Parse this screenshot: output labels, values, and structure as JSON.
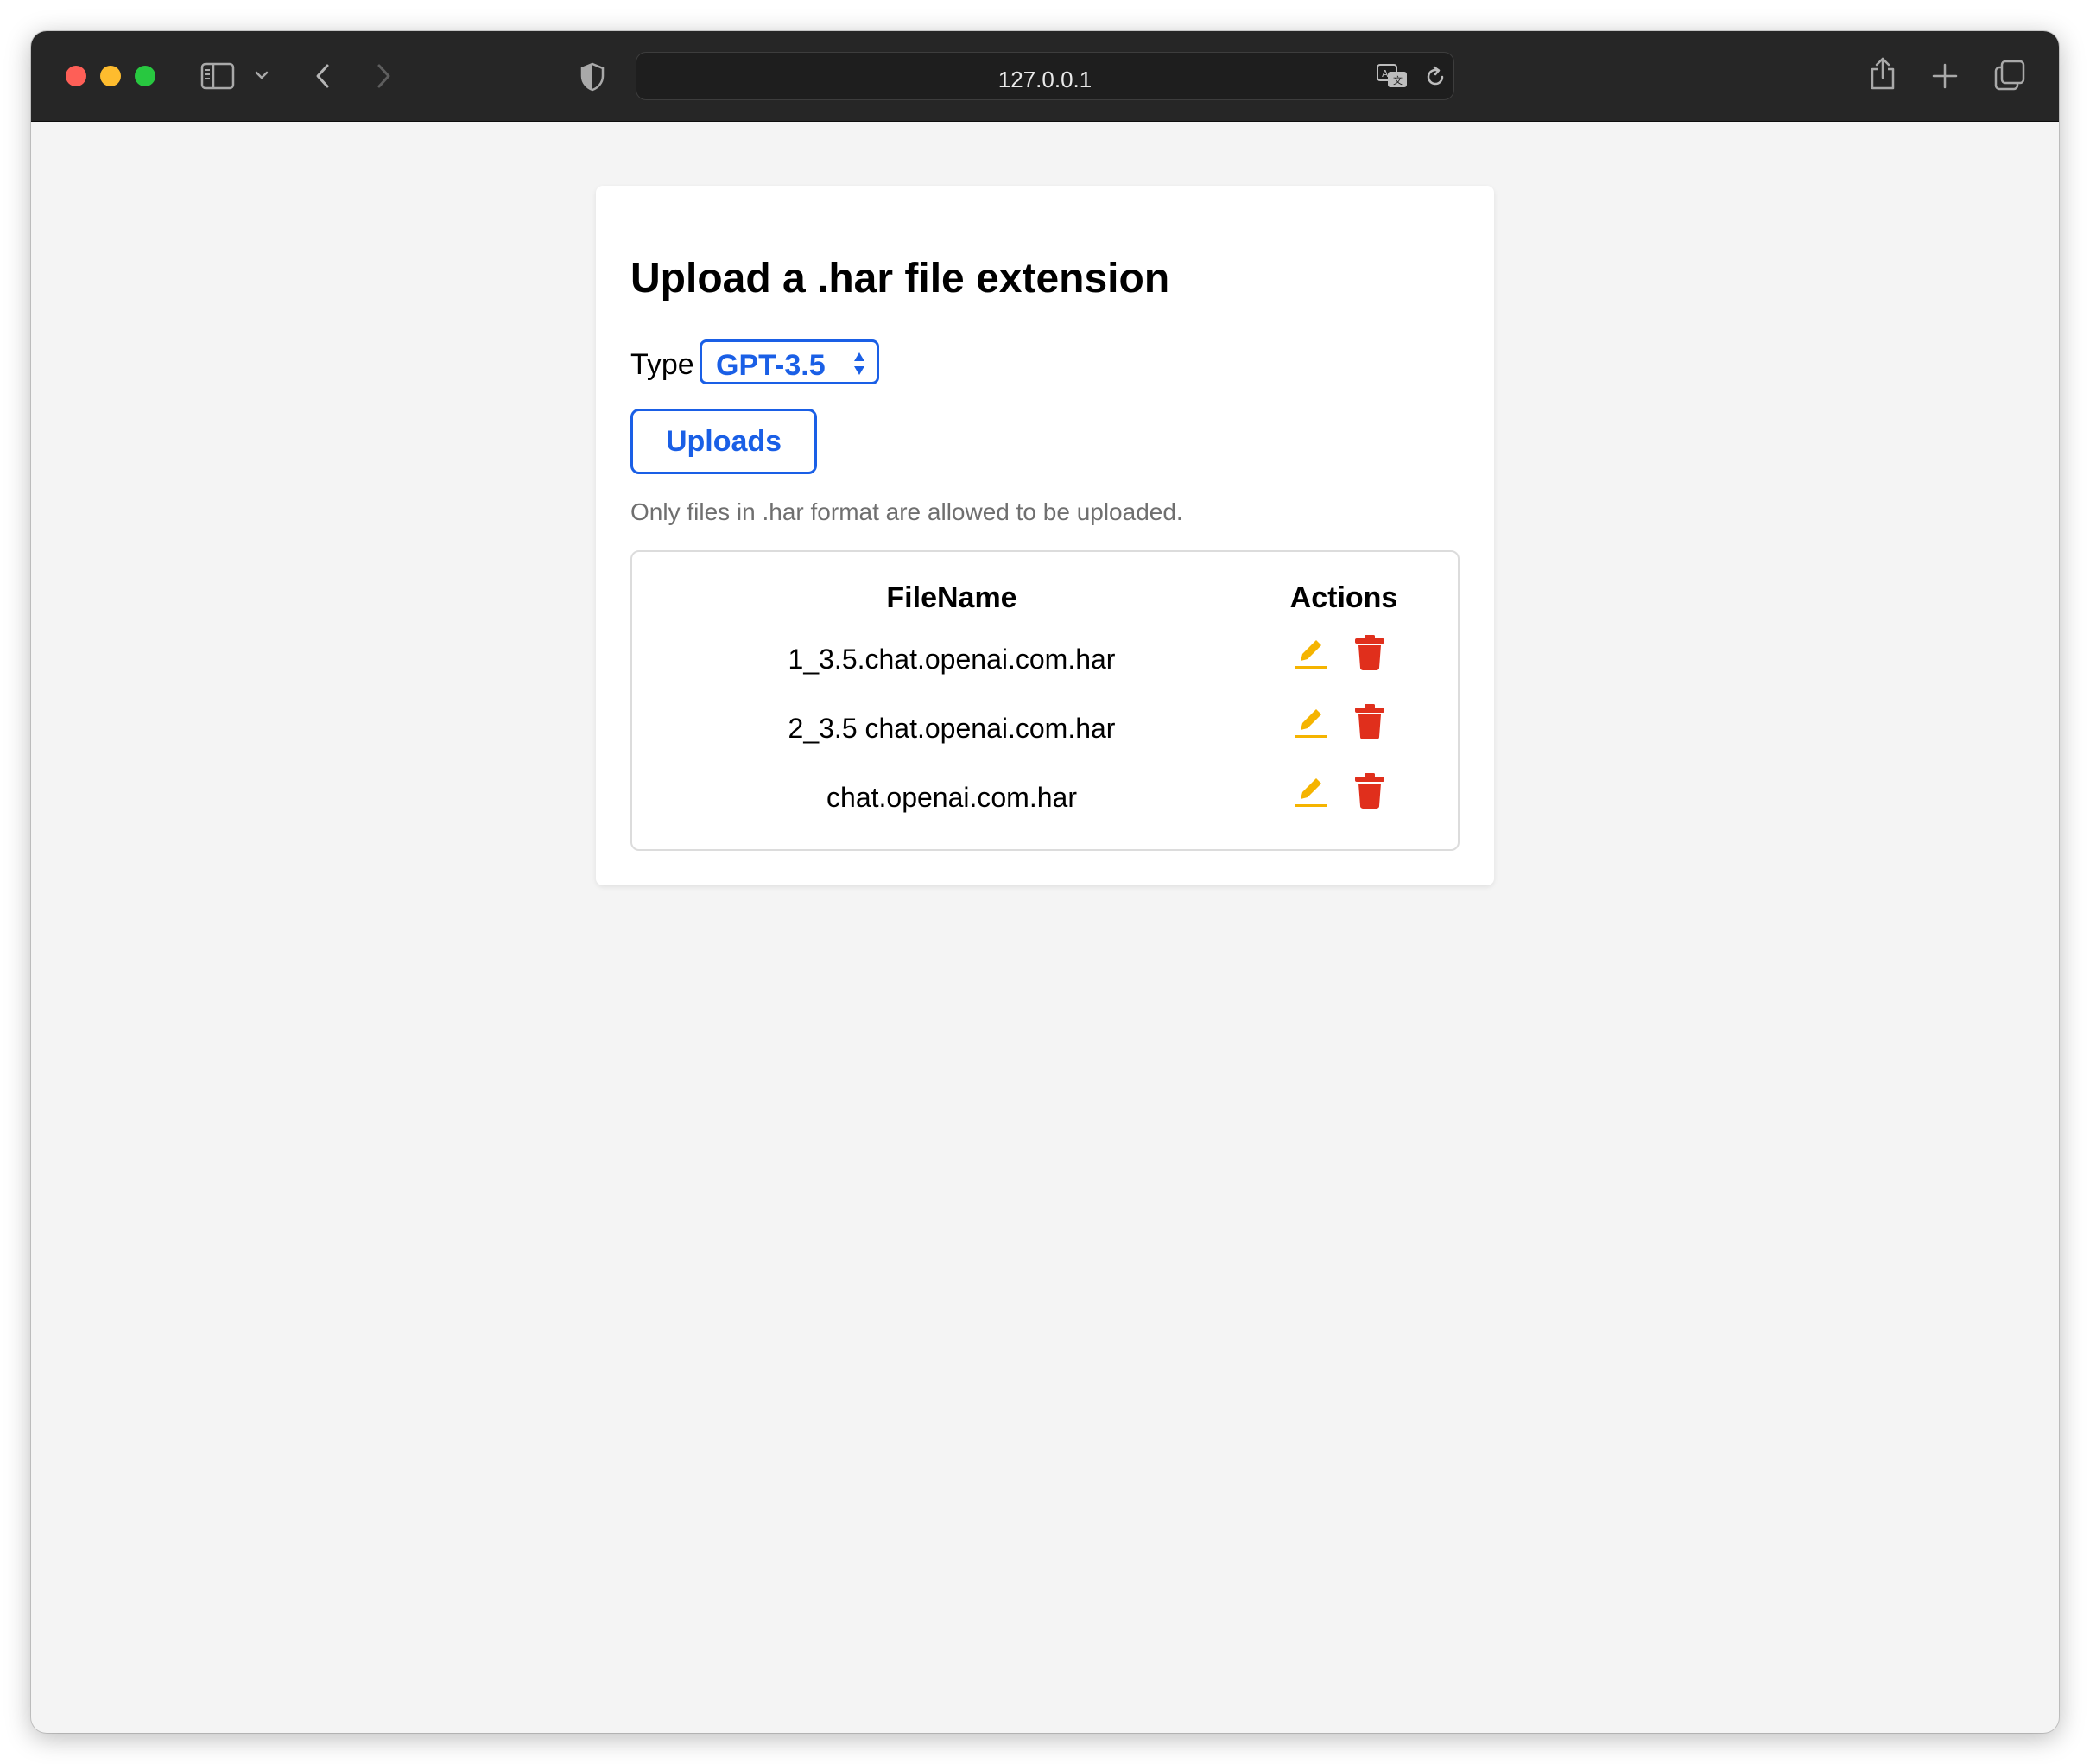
{
  "browser": {
    "url": "127.0.0.1",
    "icons": [
      "sidebar-icon",
      "chevron-down-icon",
      "back-icon",
      "forward-icon",
      "shield-icon",
      "translate-icon",
      "reload-icon",
      "share-icon",
      "new-tab-icon",
      "tab-overview-icon"
    ]
  },
  "page": {
    "title": "Upload a .har file extension",
    "type_label": "Type",
    "type_selected": "GPT-3.5",
    "upload_button": "Uploads",
    "hint": "Only files in .har format are allowed to be uploaded.",
    "table": {
      "headers": [
        "FileName",
        "Actions"
      ],
      "rows": [
        {
          "filename": "1_3.5.chat.openai.com.har"
        },
        {
          "filename": "2_3.5 chat.openai.com.har"
        },
        {
          "filename": "chat.openai.com.har"
        }
      ]
    }
  },
  "colors": {
    "accent": "#1a5fe6",
    "edit_icon": "#f5b400",
    "delete_icon": "#e02f1c",
    "toolbar": "#262626"
  }
}
